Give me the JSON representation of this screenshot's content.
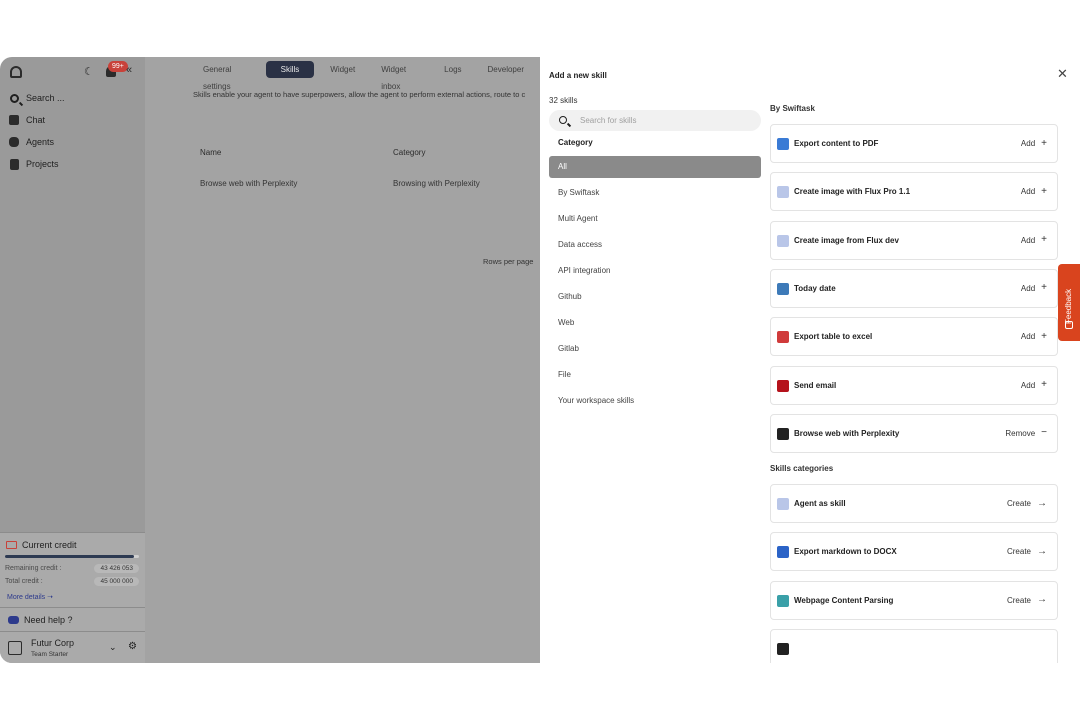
{
  "sidebar": {
    "notification_badge": "99+",
    "nav": [
      {
        "label": "Search ...",
        "icon": "search-icon"
      },
      {
        "label": "Chat",
        "icon": "chat-icon"
      },
      {
        "label": "Agents",
        "icon": "agents-icon"
      },
      {
        "label": "Projects",
        "icon": "projects-icon"
      }
    ],
    "credit": {
      "title": "Current credit",
      "remaining_label": "Remaining credit :",
      "remaining_value": "43 426 053",
      "total_label": "Total credit :",
      "total_value": "45 000 000",
      "remaining_fraction": 0.965,
      "more_details": "More details"
    },
    "help": "Need help ?",
    "org": {
      "name": "Futur Corp",
      "plan": "Team Starter"
    }
  },
  "main": {
    "tabs": [
      "General settings",
      "Skills",
      "Widget",
      "Widget inbox",
      "Logs",
      "Developer"
    ],
    "active_tab": "Skills",
    "description": "Skills enable your agent to have superpowers, allow the agent to perform external actions, route to c",
    "table": {
      "columns": [
        "Name",
        "Category"
      ],
      "rows": [
        [
          "Browse web with Perplexity",
          "Browsing with Perplexity"
        ]
      ]
    },
    "rows_per_page": "Rows per page"
  },
  "drawer": {
    "title": "Add a new skill",
    "close_icon": "close-icon",
    "count": "32 skills",
    "search_placeholder": "Search for skills",
    "category_title": "Category",
    "categories": [
      "All",
      "By Swiftask",
      "Multi Agent",
      "Data access",
      "API integration",
      "Github",
      "Web",
      "Gitlab",
      "File",
      "Your workspace skills"
    ],
    "active_category": "All",
    "sections": [
      {
        "title": "By Swiftask",
        "skills": [
          {
            "name": "Export content to PDF",
            "action": "Add",
            "symbol": "+",
            "icon": "pdf-icon",
            "color": "#3a7bd5"
          },
          {
            "name": "Create image with Flux Pro 1.1",
            "action": "Add",
            "symbol": "+",
            "icon": "flux-icon",
            "color": "#b9c6e8"
          },
          {
            "name": "Create image from Flux dev",
            "action": "Add",
            "symbol": "+",
            "icon": "flux-icon",
            "color": "#b9c6e8"
          },
          {
            "name": "Today date",
            "action": "Add",
            "symbol": "+",
            "icon": "python-icon",
            "color": "#3d7ab8"
          },
          {
            "name": "Export table to excel",
            "action": "Add",
            "symbol": "+",
            "icon": "excel-icon",
            "color": "#d03b3b"
          },
          {
            "name": "Send email",
            "action": "Add",
            "symbol": "+",
            "icon": "email-icon",
            "color": "#b5121b"
          },
          {
            "name": "Browse web with Perplexity",
            "action": "Remove",
            "symbol": "−",
            "icon": "perplexity-icon",
            "color": "#222222"
          }
        ]
      },
      {
        "title": "Skills categories",
        "skills": [
          {
            "name": "Agent as skill",
            "action": "Create",
            "symbol": "→",
            "icon": "agent-icon",
            "color": "#b9c6e8"
          },
          {
            "name": "Export markdown to DOCX",
            "action": "Create",
            "symbol": "→",
            "icon": "docx-icon",
            "color": "#2b63c7"
          },
          {
            "name": "Webpage Content Parsing",
            "action": "Create",
            "symbol": "→",
            "icon": "web-parse-icon",
            "color": "#3aa0a8"
          },
          {
            "name": "",
            "action": "",
            "symbol": "",
            "icon": "skill-icon",
            "color": "#222222"
          }
        ]
      }
    ]
  },
  "feedback": "Feedback"
}
